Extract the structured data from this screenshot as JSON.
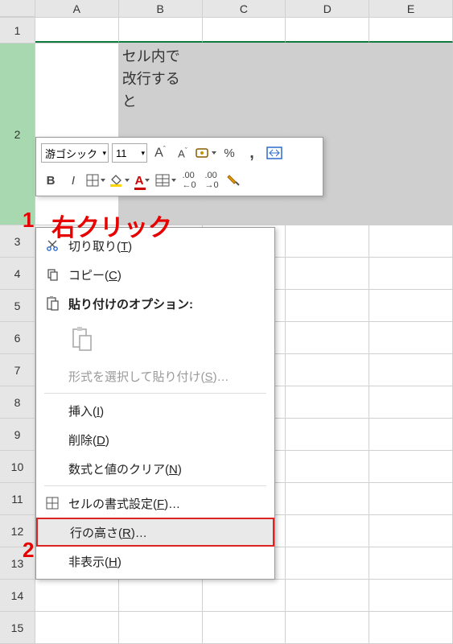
{
  "columns": [
    "A",
    "B",
    "C",
    "D",
    "E"
  ],
  "rows": {
    "r1": "1",
    "r2": "2",
    "small": [
      "3",
      "4",
      "5",
      "6",
      "7",
      "8",
      "9",
      "10",
      "11",
      "12",
      "13",
      "14",
      "15"
    ]
  },
  "cell_b2": "セル内で\n改行する\nと",
  "mini_toolbar": {
    "font_name": "游ゴシック",
    "font_size": "11",
    "buttons": {
      "increase_font": "A",
      "decrease_font": "A",
      "percent": "%",
      "comma": ",",
      "bold": "B",
      "italic": "I"
    }
  },
  "context_menu": {
    "cut": "切り取り(T)",
    "copy": "コピー(C)",
    "paste_options": "貼り付けのオプション:",
    "paste_special": "形式を選択して貼り付け(S)…",
    "insert": "挿入(I)",
    "delete": "削除(D)",
    "clear": "数式と値のクリア(N)",
    "format_cells": "セルの書式設定(F)…",
    "row_height": "行の高さ(R)…",
    "hide": "非表示(H)"
  },
  "annotations": {
    "num1": "1",
    "text1": "右クリック",
    "num2": "2"
  }
}
